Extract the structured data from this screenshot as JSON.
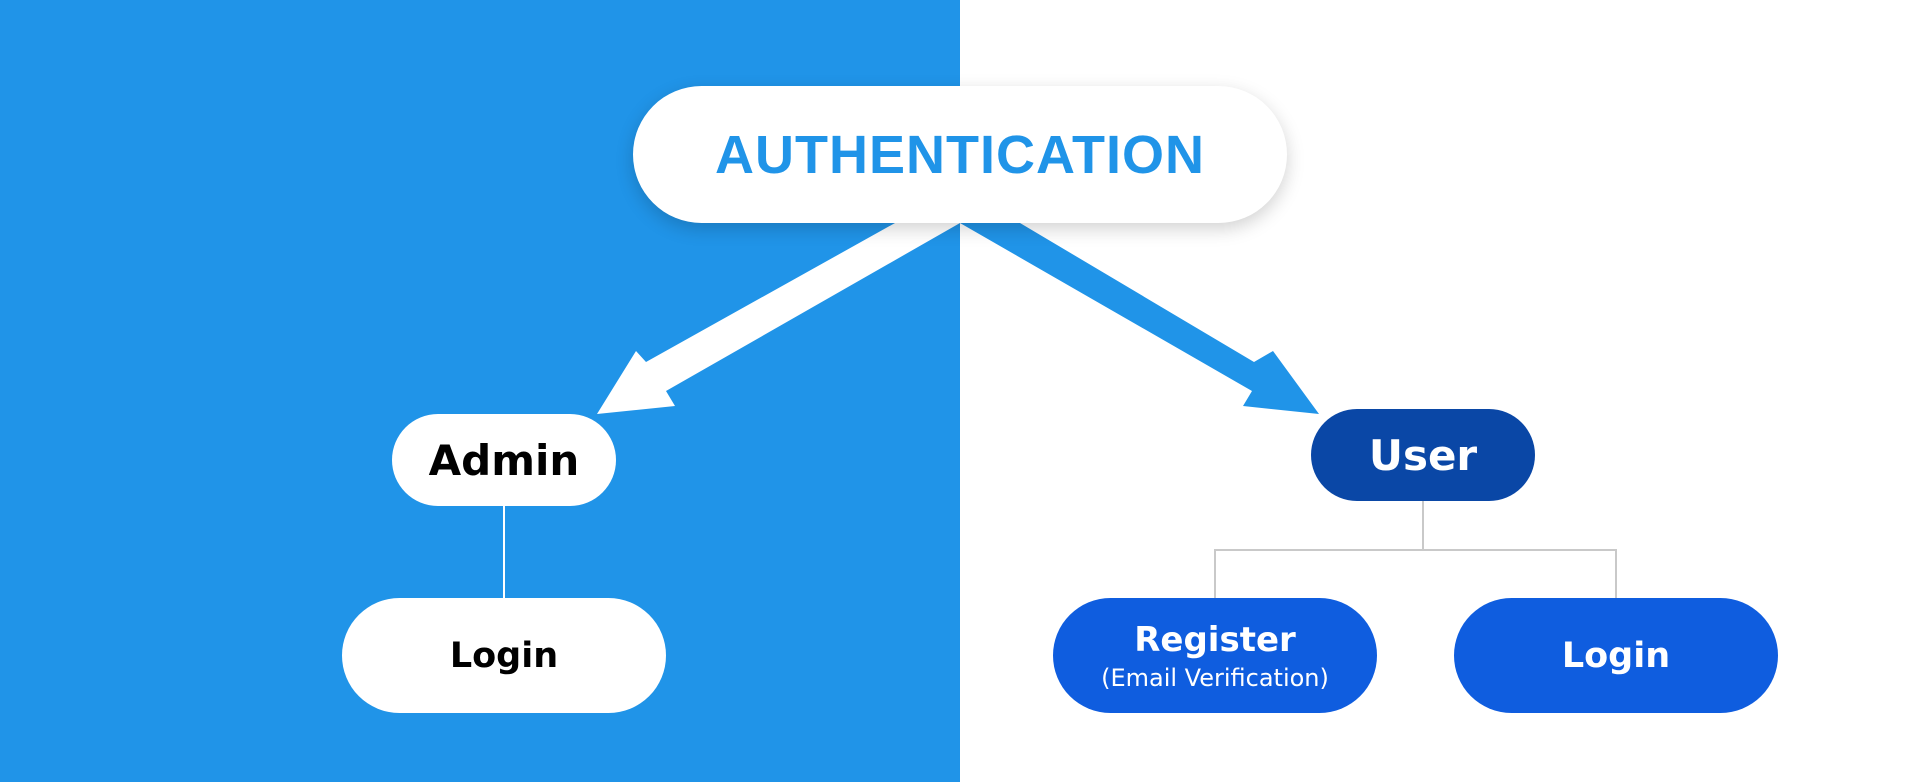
{
  "colors": {
    "left_background": "#2094e8",
    "right_background": "#ffffff",
    "accent_blue": "#2094e8",
    "user_dark_blue": "#0a47a6",
    "child_blue": "#0f5ddf",
    "connector_white": "#ffffff",
    "connector_gray": "#c9c9c9"
  },
  "diagram": {
    "root": {
      "label": "AUTHENTICATION"
    },
    "admin": {
      "label": "Admin",
      "children": [
        {
          "label": "Login"
        }
      ]
    },
    "user": {
      "label": "User",
      "children": [
        {
          "label": "Register",
          "sublabel": "(Email Verification)"
        },
        {
          "label": "Login"
        }
      ]
    }
  }
}
